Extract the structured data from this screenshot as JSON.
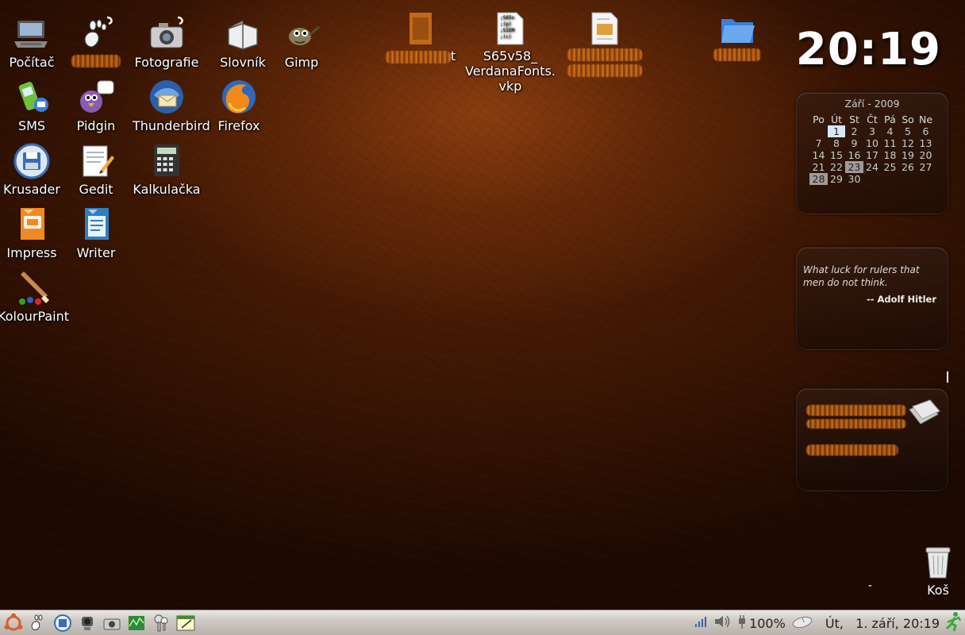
{
  "desktop": {
    "icons_col1": [
      {
        "label": "Počítač",
        "icon": "computer-icon"
      },
      {
        "label": "SMS",
        "icon": "sms-icon"
      },
      {
        "label": "Krusader",
        "icon": "krusader-icon"
      },
      {
        "label": "Impress",
        "icon": "impress-icon"
      },
      {
        "label": "KolourPaint",
        "icon": "kolourpaint-icon"
      }
    ],
    "icons_col2": [
      {
        "label": "",
        "icon": "gnome-foot-icon"
      },
      {
        "label": "Pidgin",
        "icon": "pidgin-icon"
      },
      {
        "label": "Gedit",
        "icon": "gedit-icon"
      },
      {
        "label": "Writer",
        "icon": "writer-icon"
      }
    ],
    "icons_col3": [
      {
        "label": "Fotografie",
        "icon": "camera-icon"
      },
      {
        "label": "Thunderbird",
        "icon": "thunderbird-icon"
      },
      {
        "label": "Kalkulačka",
        "icon": "calculator-icon"
      }
    ],
    "icons_col4": [
      {
        "label": "Slovník",
        "icon": "dictionary-icon"
      },
      {
        "label": "Firefox",
        "icon": "firefox-icon"
      }
    ],
    "icons_col5": [
      {
        "label": "Gimp",
        "icon": "gimp-icon"
      }
    ],
    "top_files": {
      "file1_suffix": "t",
      "file2_line1": "S65v58_",
      "file2_line2": "VerdanaFonts.",
      "file2_line3": "vkp"
    },
    "trash_label": "Koš",
    "dash_text": "-",
    "cursor_text": "I"
  },
  "clock": {
    "time": "20:19"
  },
  "calendar": {
    "header": "Září - 2009",
    "weekdays": [
      "Po",
      "Út",
      "St",
      "Čt",
      "Pá",
      "So",
      "Ne"
    ],
    "weeks": [
      [
        "",
        "1",
        "2",
        "3",
        "4",
        "5",
        "6"
      ],
      [
        "7",
        "8",
        "9",
        "10",
        "11",
        "12",
        "13"
      ],
      [
        "14",
        "15",
        "16",
        "17",
        "18",
        "19",
        "20"
      ],
      [
        "21",
        "22",
        "23",
        "24",
        "25",
        "26",
        "27"
      ],
      [
        "28",
        "29",
        "30",
        "",
        "",
        "",
        ""
      ]
    ],
    "today": "1",
    "marked": [
      "23",
      "28"
    ]
  },
  "quote": {
    "text": "What luck for rulers that men do not think.",
    "author": "-- Adolf Hitler"
  },
  "taskbar": {
    "battery": "100%",
    "datetime": "Út,   1. září, 20:19"
  },
  "colors": {
    "wallpaper": "#5a2306",
    "taskbar": "#cfcbc4"
  }
}
